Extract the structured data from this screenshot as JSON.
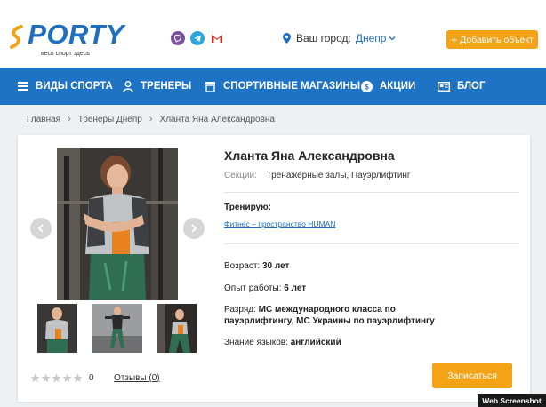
{
  "header": {
    "logo_text": "SPORTY",
    "logo_tagline": "весь спорт здесь",
    "city_label": "Ваш город:",
    "city_value": "Днепр",
    "add_button": "Добавить объект"
  },
  "nav": {
    "items": [
      {
        "label": "ВИДЫ СПОРТА",
        "icon": "menu-icon"
      },
      {
        "label": "ТРЕНЕРЫ",
        "icon": "trainer-icon"
      },
      {
        "label": "СПОРТИВНЫЕ МАГАЗИНЫ",
        "icon": "shop-icon"
      },
      {
        "label": "АКЦИИ",
        "icon": "discount-icon"
      },
      {
        "label": "БЛОГ",
        "icon": "blog-icon"
      }
    ]
  },
  "breadcrumb": [
    "Главная",
    "Тренеры Днепр",
    "Хланта Яна Александровна"
  ],
  "profile": {
    "name": "Хланта Яна Александровна",
    "sections_label": "Секции:",
    "sections_value": "Тренажерные залы,  Пауэрлифтинг",
    "trains_label": "Тренирую:",
    "gym_link": "Фитнес – пространство HUMAN",
    "age_label": "Возраст:",
    "age_value": "30 лет",
    "experience_label": "Опыт работы:",
    "experience_value": "6 лет",
    "rank_label": "Разряд:",
    "rank_value": "МС международного класса по пауэрлифтингу, МС Украины по пауэрлифтингу",
    "languages_label": "Знание языков:",
    "languages_value": "английский",
    "rating_count": "0",
    "reviews_link": "Отзывы (0)",
    "rating_stars": 0,
    "signup_button": "Записаться"
  },
  "watermark": "Web Screenshot",
  "colors": {
    "brand_blue": "#1f73c4",
    "accent_orange": "#f5a316"
  }
}
